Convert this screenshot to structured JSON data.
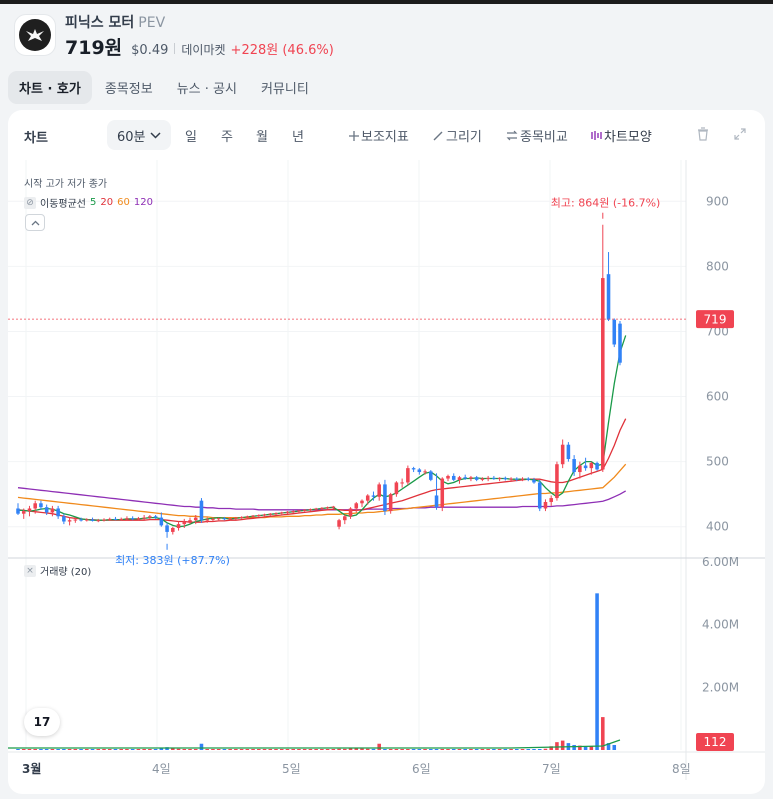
{
  "stock": {
    "name": "피닉스 모터",
    "ticker": "PEV",
    "price": "719원",
    "usd_price": "$0.49",
    "market": "데이마켓",
    "change": "+228원 (46.6%)"
  },
  "tabs": [
    "차트 · 호가",
    "종목정보",
    "뉴스 · 공시",
    "커뮤니티"
  ],
  "toolbar": {
    "title": "차트",
    "interval": "60분",
    "periods": [
      "일",
      "주",
      "월",
      "년"
    ],
    "indicator": "보조지표",
    "draw": "그리기",
    "compare": "종목비교",
    "shape": "차트모양"
  },
  "legend": {
    "ohlc": "시작 고가 저가 종가",
    "ma_label": "이동평균선",
    "ma_periods": [
      "5",
      "20",
      "60",
      "120"
    ],
    "volume_label": "거래량 (20)",
    "tv_logo": "17"
  },
  "colors": {
    "up": "#f04452",
    "down": "#3182f6",
    "ma5": "#1a9a49",
    "ma20": "#e0323a",
    "ma60": "#f08a1c",
    "ma120": "#8e2fb5"
  },
  "chart_data": {
    "type": "candlestick",
    "y_axis": {
      "ticks": [
        400,
        500,
        600,
        700,
        800,
        900
      ],
      "range": [
        355,
        945
      ]
    },
    "volume_axis": {
      "ticks": [
        "2.00M",
        "4.00M",
        "6.00M"
      ],
      "range": [
        0,
        6000000
      ]
    },
    "x_labels": [
      "3월",
      "4일",
      "5일",
      "6일",
      "7일",
      "8일"
    ],
    "last_price": {
      "value": 719,
      "label": "719"
    },
    "last_volume": {
      "label": "112"
    },
    "high_annotation": {
      "value": 864,
      "label": "최고: 864원 (-16.7%)"
    },
    "low_annotation": {
      "value": 383,
      "label": "최저: 383원 (+87.7%)"
    },
    "candles": [
      {
        "o": 428,
        "h": 436,
        "l": 418,
        "c": 420
      },
      {
        "o": 420,
        "h": 428,
        "l": 412,
        "c": 424
      },
      {
        "o": 424,
        "h": 432,
        "l": 416,
        "c": 428
      },
      {
        "o": 428,
        "h": 440,
        "l": 420,
        "c": 436
      },
      {
        "o": 436,
        "h": 440,
        "l": 426,
        "c": 430
      },
      {
        "o": 430,
        "h": 434,
        "l": 418,
        "c": 422
      },
      {
        "o": 422,
        "h": 432,
        "l": 416,
        "c": 428
      },
      {
        "o": 428,
        "h": 432,
        "l": 412,
        "c": 416
      },
      {
        "o": 416,
        "h": 420,
        "l": 404,
        "c": 408
      },
      {
        "o": 408,
        "h": 414,
        "l": 402,
        "c": 410
      },
      {
        "o": 410,
        "h": 414,
        "l": 406,
        "c": 411
      },
      {
        "o": 411,
        "h": 414,
        "l": 408,
        "c": 410
      },
      {
        "o": 410,
        "h": 413,
        "l": 408,
        "c": 411
      },
      {
        "o": 411,
        "h": 414,
        "l": 408,
        "c": 409
      },
      {
        "o": 409,
        "h": 412,
        "l": 407,
        "c": 410
      },
      {
        "o": 410,
        "h": 413,
        "l": 408,
        "c": 411
      },
      {
        "o": 411,
        "h": 414,
        "l": 409,
        "c": 412
      },
      {
        "o": 412,
        "h": 415,
        "l": 410,
        "c": 411
      },
      {
        "o": 411,
        "h": 414,
        "l": 409,
        "c": 412
      },
      {
        "o": 412,
        "h": 416,
        "l": 410,
        "c": 413
      },
      {
        "o": 413,
        "h": 416,
        "l": 410,
        "c": 412
      },
      {
        "o": 412,
        "h": 415,
        "l": 410,
        "c": 413
      },
      {
        "o": 413,
        "h": 418,
        "l": 411,
        "c": 414
      },
      {
        "o": 414,
        "h": 418,
        "l": 412,
        "c": 416
      },
      {
        "o": 416,
        "h": 418,
        "l": 412,
        "c": 414
      },
      {
        "o": 414,
        "h": 422,
        "l": 400,
        "c": 402
      },
      {
        "o": 402,
        "h": 406,
        "l": 383,
        "c": 392
      },
      {
        "o": 392,
        "h": 400,
        "l": 388,
        "c": 398
      },
      {
        "o": 398,
        "h": 408,
        "l": 394,
        "c": 404
      },
      {
        "o": 404,
        "h": 412,
        "l": 398,
        "c": 408
      },
      {
        "o": 408,
        "h": 414,
        "l": 404,
        "c": 410
      },
      {
        "o": 410,
        "h": 418,
        "l": 404,
        "c": 414
      },
      {
        "o": 440,
        "h": 444,
        "l": 406,
        "c": 410
      },
      {
        "o": 410,
        "h": 414,
        "l": 406,
        "c": 411
      },
      {
        "o": 411,
        "h": 414,
        "l": 408,
        "c": 412
      },
      {
        "o": 412,
        "h": 414,
        "l": 410,
        "c": 413
      },
      {
        "o": 413,
        "h": 415,
        "l": 410,
        "c": 412
      },
      {
        "o": 412,
        "h": 414,
        "l": 410,
        "c": 413
      },
      {
        "o": 413,
        "h": 415,
        "l": 411,
        "c": 414
      },
      {
        "o": 414,
        "h": 416,
        "l": 412,
        "c": 415
      },
      {
        "o": 415,
        "h": 417,
        "l": 413,
        "c": 416
      },
      {
        "o": 416,
        "h": 418,
        "l": 414,
        "c": 417
      },
      {
        "o": 417,
        "h": 419,
        "l": 415,
        "c": 418
      },
      {
        "o": 418,
        "h": 420,
        "l": 416,
        "c": 419
      },
      {
        "o": 419,
        "h": 421,
        "l": 417,
        "c": 420
      },
      {
        "o": 420,
        "h": 422,
        "l": 418,
        "c": 421
      },
      {
        "o": 421,
        "h": 423,
        "l": 419,
        "c": 422
      },
      {
        "o": 422,
        "h": 424,
        "l": 420,
        "c": 423
      },
      {
        "o": 423,
        "h": 425,
        "l": 421,
        "c": 424
      },
      {
        "o": 424,
        "h": 426,
        "l": 422,
        "c": 425
      },
      {
        "o": 425,
        "h": 427,
        "l": 423,
        "c": 426
      },
      {
        "o": 426,
        "h": 428,
        "l": 424,
        "c": 427
      },
      {
        "o": 427,
        "h": 429,
        "l": 425,
        "c": 428
      },
      {
        "o": 428,
        "h": 430,
        "l": 426,
        "c": 429
      },
      {
        "o": 429,
        "h": 431,
        "l": 427,
        "c": 430
      },
      {
        "o": 430,
        "h": 432,
        "l": 428,
        "c": 431
      },
      {
        "o": 400,
        "h": 412,
        "l": 396,
        "c": 410
      },
      {
        "o": 410,
        "h": 418,
        "l": 404,
        "c": 416
      },
      {
        "o": 416,
        "h": 430,
        "l": 412,
        "c": 428
      },
      {
        "o": 428,
        "h": 438,
        "l": 422,
        "c": 436
      },
      {
        "o": 436,
        "h": 442,
        "l": 430,
        "c": 440
      },
      {
        "o": 440,
        "h": 450,
        "l": 434,
        "c": 448
      },
      {
        "o": 448,
        "h": 454,
        "l": 440,
        "c": 446
      },
      {
        "o": 446,
        "h": 468,
        "l": 440,
        "c": 465
      },
      {
        "o": 465,
        "h": 472,
        "l": 418,
        "c": 424
      },
      {
        "o": 424,
        "h": 452,
        "l": 420,
        "c": 450
      },
      {
        "o": 450,
        "h": 470,
        "l": 446,
        "c": 468
      },
      {
        "o": 468,
        "h": 474,
        "l": 460,
        "c": 468
      },
      {
        "o": 468,
        "h": 494,
        "l": 464,
        "c": 490
      },
      {
        "o": 490,
        "h": 492,
        "l": 484,
        "c": 488
      },
      {
        "o": 488,
        "h": 490,
        "l": 480,
        "c": 484
      },
      {
        "o": 484,
        "h": 488,
        "l": 480,
        "c": 485
      },
      {
        "o": 485,
        "h": 487,
        "l": 470,
        "c": 472
      },
      {
        "o": 448,
        "h": 482,
        "l": 426,
        "c": 430
      },
      {
        "o": 430,
        "h": 476,
        "l": 424,
        "c": 474
      },
      {
        "o": 474,
        "h": 480,
        "l": 470,
        "c": 478
      },
      {
        "o": 478,
        "h": 482,
        "l": 470,
        "c": 472
      },
      {
        "o": 472,
        "h": 478,
        "l": 466,
        "c": 476
      },
      {
        "o": 476,
        "h": 480,
        "l": 472,
        "c": 474
      },
      {
        "o": 474,
        "h": 478,
        "l": 470,
        "c": 476
      },
      {
        "o": 476,
        "h": 478,
        "l": 470,
        "c": 472
      },
      {
        "o": 472,
        "h": 476,
        "l": 470,
        "c": 474
      },
      {
        "o": 474,
        "h": 478,
        "l": 470,
        "c": 475
      },
      {
        "o": 475,
        "h": 478,
        "l": 472,
        "c": 474
      },
      {
        "o": 474,
        "h": 476,
        "l": 470,
        "c": 475
      },
      {
        "o": 475,
        "h": 477,
        "l": 471,
        "c": 473
      },
      {
        "o": 473,
        "h": 476,
        "l": 470,
        "c": 474
      },
      {
        "o": 474,
        "h": 476,
        "l": 470,
        "c": 473
      },
      {
        "o": 473,
        "h": 476,
        "l": 470,
        "c": 474
      },
      {
        "o": 474,
        "h": 476,
        "l": 470,
        "c": 472
      },
      {
        "o": 472,
        "h": 475,
        "l": 466,
        "c": 468
      },
      {
        "o": 468,
        "h": 472,
        "l": 424,
        "c": 428
      },
      {
        "o": 428,
        "h": 442,
        "l": 424,
        "c": 438
      },
      {
        "o": 438,
        "h": 448,
        "l": 432,
        "c": 444
      },
      {
        "o": 444,
        "h": 500,
        "l": 440,
        "c": 496
      },
      {
        "o": 496,
        "h": 534,
        "l": 490,
        "c": 526
      },
      {
        "o": 526,
        "h": 530,
        "l": 500,
        "c": 504
      },
      {
        "o": 504,
        "h": 510,
        "l": 478,
        "c": 484
      },
      {
        "o": 484,
        "h": 500,
        "l": 474,
        "c": 494
      },
      {
        "o": 494,
        "h": 506,
        "l": 486,
        "c": 490
      },
      {
        "o": 490,
        "h": 500,
        "l": 480,
        "c": 498
      },
      {
        "o": 498,
        "h": 500,
        "l": 486,
        "c": 488
      },
      {
        "o": 488,
        "h": 864,
        "l": 484,
        "c": 782
      },
      {
        "o": 788,
        "h": 822,
        "l": 716,
        "c": 718
      },
      {
        "o": 718,
        "h": 720,
        "l": 676,
        "c": 680
      },
      {
        "o": 712,
        "h": 716,
        "l": 648,
        "c": 652
      }
    ],
    "volumes": [
      30,
      28,
      32,
      26,
      24,
      22,
      20,
      18,
      22,
      25,
      20,
      18,
      16,
      15,
      14,
      16,
      18,
      22,
      20,
      24,
      28,
      24,
      22,
      20,
      24,
      60,
      90,
      70,
      40,
      30,
      25,
      22,
      200,
      20,
      18,
      16,
      14,
      12,
      10,
      12,
      14,
      12,
      10,
      10,
      12,
      14,
      12,
      10,
      10,
      12,
      14,
      12,
      10,
      12,
      14,
      16,
      40,
      35,
      50,
      60,
      45,
      40,
      35,
      200,
      30,
      25,
      22,
      28,
      24,
      22,
      20,
      26,
      24,
      22,
      20,
      18,
      16,
      14,
      12,
      14,
      16,
      18,
      20,
      16,
      14,
      12,
      14,
      16,
      14,
      12,
      10,
      20,
      40,
      120,
      250,
      300,
      220,
      160,
      140,
      100,
      120,
      5000,
      1050,
      220,
      160
    ],
    "ma5": [
      425,
      425,
      424,
      425,
      427,
      428,
      427,
      424,
      420,
      418,
      415,
      412,
      411,
      410,
      410,
      410,
      411,
      411,
      411,
      412,
      412,
      412,
      413,
      414,
      414,
      412,
      406,
      402,
      400,
      401,
      404,
      408,
      410,
      412,
      413,
      414,
      413,
      412,
      413,
      414,
      415,
      416,
      417,
      418,
      419,
      420,
      421,
      422,
      423,
      424,
      425,
      426,
      427,
      428,
      429,
      430,
      424,
      418,
      416,
      418,
      426,
      436,
      444,
      450,
      446,
      448,
      452,
      458,
      464,
      470,
      476,
      482,
      484,
      478,
      470,
      466,
      468,
      472,
      474,
      474,
      475,
      474,
      474,
      474,
      474,
      474,
      473,
      473,
      473,
      473,
      472,
      470,
      460,
      452,
      446,
      452,
      470,
      486,
      494,
      500,
      500,
      494,
      496,
      560,
      620,
      668,
      694
    ],
    "ma20": [
      426,
      425,
      424,
      423,
      422,
      421,
      420,
      418,
      416,
      414,
      413,
      412,
      411,
      411,
      410,
      410,
      410,
      410,
      410,
      410,
      410,
      410,
      410,
      411,
      411,
      411,
      410,
      409,
      408,
      408,
      407,
      407,
      407,
      408,
      408,
      409,
      409,
      410,
      410,
      411,
      412,
      413,
      414,
      415,
      416,
      417,
      418,
      419,
      420,
      421,
      422,
      423,
      424,
      425,
      426,
      427,
      426,
      425,
      425,
      425,
      426,
      428,
      430,
      432,
      434,
      436,
      438,
      440,
      443,
      446,
      449,
      452,
      455,
      457,
      458,
      459,
      460,
      461,
      462,
      463,
      464,
      465,
      466,
      467,
      468,
      469,
      470,
      471,
      472,
      473,
      473,
      473,
      471,
      469,
      468,
      468,
      470,
      473,
      476,
      479,
      482,
      485,
      488,
      505,
      525,
      548,
      566
    ],
    "ma60": [
      445,
      444,
      443,
      442,
      441,
      440,
      439,
      438,
      437,
      436,
      435,
      434,
      433,
      432,
      431,
      430,
      429,
      428,
      427,
      426,
      425,
      424,
      423,
      422,
      421,
      420,
      419,
      418,
      417,
      417,
      416,
      416,
      415,
      415,
      414,
      414,
      414,
      414,
      414,
      414,
      414,
      414,
      414,
      414,
      415,
      415,
      415,
      416,
      416,
      416,
      417,
      417,
      418,
      418,
      419,
      419,
      419,
      420,
      420,
      421,
      421,
      422,
      422,
      423,
      424,
      425,
      426,
      427,
      428,
      429,
      430,
      431,
      432,
      433,
      434,
      435,
      436,
      437,
      438,
      439,
      440,
      441,
      442,
      443,
      444,
      445,
      446,
      447,
      448,
      449,
      450,
      451,
      451,
      452,
      452,
      453,
      454,
      455,
      456,
      457,
      458,
      459,
      460,
      468,
      476,
      486,
      496
    ],
    "ma120": [
      460,
      459,
      458,
      457,
      456,
      455,
      454,
      453,
      452,
      451,
      450,
      449,
      448,
      447,
      446,
      445,
      444,
      443,
      442,
      441,
      440,
      439,
      438,
      437,
      436,
      435,
      434,
      433,
      432,
      431,
      431,
      430,
      430,
      429,
      429,
      428,
      428,
      428,
      427,
      427,
      427,
      427,
      426,
      426,
      426,
      426,
      426,
      426,
      426,
      426,
      426,
      426,
      426,
      426,
      426,
      426,
      426,
      426,
      426,
      426,
      426,
      427,
      427,
      427,
      427,
      428,
      428,
      428,
      428,
      429,
      429,
      429,
      430,
      430,
      430,
      430,
      430,
      430,
      430,
      430,
      430,
      430,
      430,
      430,
      430,
      430,
      430,
      430,
      431,
      431,
      431,
      431,
      431,
      431,
      432,
      432,
      433,
      434,
      435,
      436,
      437,
      438,
      439,
      442,
      446,
      450,
      455
    ]
  }
}
